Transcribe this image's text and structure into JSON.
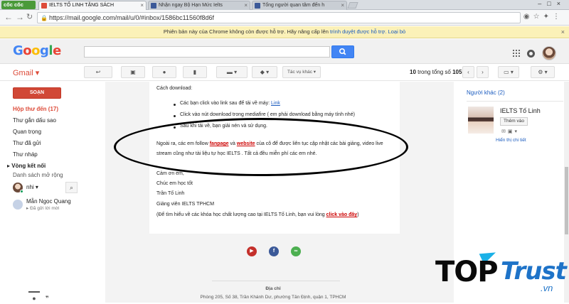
{
  "browser": {
    "brand": "cốc cốc",
    "tabs": [
      {
        "title": "IELTS TỐ LINH TẶNG SÁCH"
      },
      {
        "title": "Nhận ngay Bộ Hạn Mức Ielts"
      },
      {
        "title": "Tổng người quan tâm đến h"
      }
    ],
    "url": "https://mail.google.com/mail/u/0/#inbox/1586bc11560f8d6f"
  },
  "infobar": {
    "message": "Phiên bản này của Chrome không còn được hỗ trợ. Hãy nâng cấp lên",
    "link": "trình duyệt được hỗ trợ.",
    "dismiss": "Loại bỏ"
  },
  "google": {
    "logo": "Google"
  },
  "gmail": {
    "label": "Gmail",
    "more_label": "Tác vụ khác",
    "pager": {
      "range": "10",
      "of_text": "trong tổng số",
      "total": "105"
    }
  },
  "nav": {
    "compose": "SOẠN",
    "items": [
      {
        "label": "Hộp thư đến (17)"
      },
      {
        "label": "Thư gắn dấu sao"
      },
      {
        "label": "Quan trọng"
      },
      {
        "label": "Thư đã gửi"
      },
      {
        "label": "Thư nháp"
      },
      {
        "label": "Vòng kết nối"
      },
      {
        "label": "Danh sách mở rộng"
      }
    ],
    "hangouts_user": "nhi",
    "contact": {
      "name": "Mẫn Ngọc Quang",
      "status": "Đã gửi lời mời"
    }
  },
  "message": {
    "download_heading": "Cách download:",
    "bullets": [
      {
        "text": "Các bạn click vào link sau để tải về máy:",
        "link": "Link"
      },
      {
        "text": "Click vào nút download trong mediafire ( em phải download bằng máy tính nhé)"
      },
      {
        "text": "Sau khi tải về, bạn giải nén và sử dụng."
      }
    ],
    "para1_a": "Ngoài ra, các em follow",
    "fanpage": "fanpage",
    "para1_b": "và",
    "website": "website",
    "para1_c": "của cô để được liên tục cập nhật các bài giảng, video live",
    "para1_line2": "stream cũng như tài liệu tự học IELTS . Tất cả đều miễn phí các em nhé.",
    "thanks": "Cảm ơn em,",
    "wish": "Chúc em học tốt",
    "sig_name": "Trần Tố Linh",
    "sig_title": "Giảng viên IELTS TPHCM",
    "note": "(Để tìm hiểu về các khóa học chất lượng cao tại IELTS Tố Linh, bạn vui lòng",
    "note_link": "click vào đây",
    "note_end": ")",
    "address_label": "Địa chỉ",
    "address": "Phòng 205, Số 38, Trần Khánh Dư, phường Tân Định, quận 1, TPHCM"
  },
  "right_panel": {
    "others": "Người khác (2)",
    "contact_name": "IELTS Tố Linh",
    "add_button": "Thêm vào",
    "details": "Hiển thị chi tiết"
  },
  "watermark": {
    "top": "TOP",
    "trust": "Trust",
    "vn": ".vn"
  },
  "colors": {
    "gmail_red": "#dd4b39",
    "google_blue": "#4285f4",
    "link_blue": "#1a5bbf",
    "infobar_bg": "#fbf1b8"
  }
}
